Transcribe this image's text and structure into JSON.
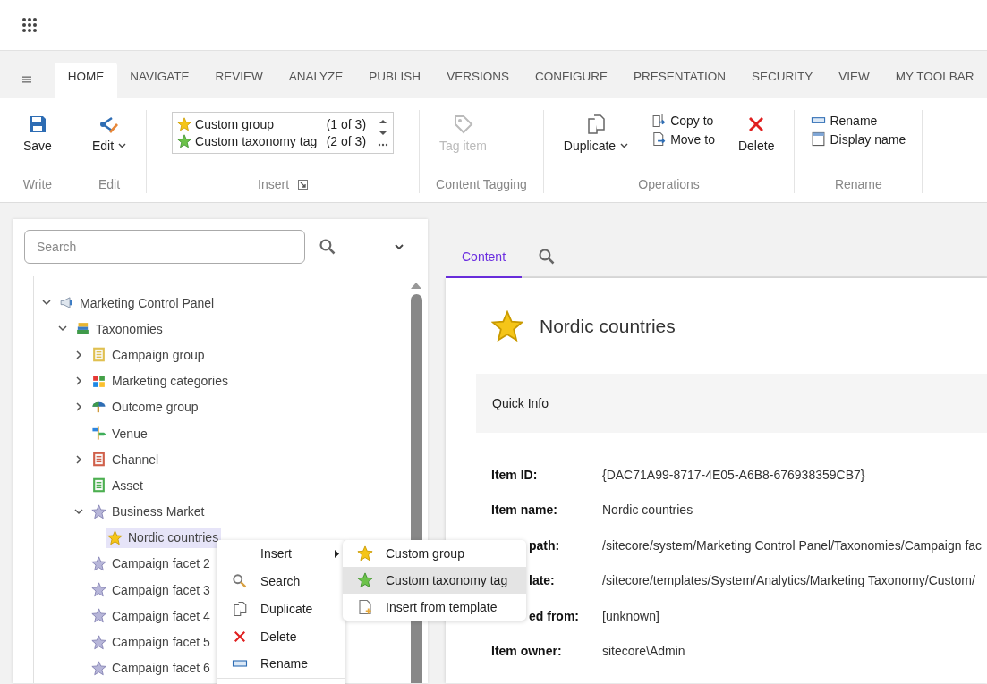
{
  "tabs": [
    {
      "label": "HOME",
      "selected": true
    },
    {
      "label": "NAVIGATE",
      "selected": false
    },
    {
      "label": "REVIEW",
      "selected": false
    },
    {
      "label": "ANALYZE",
      "selected": false
    },
    {
      "label": "PUBLISH",
      "selected": false
    },
    {
      "label": "VERSIONS",
      "selected": false
    },
    {
      "label": "CONFIGURE",
      "selected": false
    },
    {
      "label": "PRESENTATION",
      "selected": false
    },
    {
      "label": "SECURITY",
      "selected": false
    },
    {
      "label": "VIEW",
      "selected": false
    },
    {
      "label": "MY TOOLBAR",
      "selected": false
    }
  ],
  "ribbon": [
    {
      "label": "Write",
      "columns": [
        [
          {
            "kind": "save",
            "label": "Save",
            "disabled": false
          }
        ]
      ]
    },
    {
      "label": "Edit",
      "columns": [
        [
          {
            "kind": "edit",
            "label": "Edit",
            "dropdown": true,
            "disabled": false
          }
        ]
      ]
    },
    {
      "label": "Insert",
      "launcher": true,
      "gallery": [
        {
          "label": "Custom group",
          "count": "(1 of 3)",
          "color": "#f5c518"
        },
        {
          "label": "Custom taxonomy tag",
          "count": "(2 of 3)",
          "color": "#6cc24a"
        }
      ]
    },
    {
      "label": "Content Tagging",
      "columns": [
        [
          {
            "kind": "tag",
            "label": "Tag item",
            "disabled": true
          }
        ]
      ]
    },
    {
      "label": "Operations",
      "columns": [
        [
          {
            "kind": "duplicate",
            "label": "Duplicate",
            "dropdown": true,
            "disabled": false
          }
        ],
        [
          {
            "kind": "copy",
            "label": "Copy to",
            "disabled": false
          },
          {
            "kind": "move",
            "label": "Move to",
            "disabled": false
          }
        ],
        [
          {
            "kind": "delete",
            "label": "Delete",
            "disabled": false
          }
        ]
      ]
    },
    {
      "label": "Rename",
      "columns": [
        [
          {
            "kind": "rename",
            "label": "Rename",
            "disabled": false
          },
          {
            "kind": "display",
            "label": "Display name",
            "disabled": false
          }
        ]
      ]
    }
  ],
  "tree_search": {
    "placeholder": "Search"
  },
  "tree": [
    {
      "label": "Marketing Control Panel",
      "kind": "megaphone",
      "expanded": true,
      "selected": false,
      "children": [
        {
          "label": "Taxonomies",
          "kind": "books",
          "expanded": true,
          "selected": false,
          "children": [
            {
              "label": "Campaign group",
              "kind": "sheet",
              "color": "#e0c050",
              "expanded": false,
              "selected": false
            },
            {
              "label": "Marketing categories",
              "kind": "cube",
              "expanded": false,
              "selected": false
            },
            {
              "label": "Outcome group",
              "kind": "umbrella",
              "expanded": false,
              "selected": false
            },
            {
              "label": "Venue",
              "kind": "signpost",
              "selected": false
            },
            {
              "label": "Channel",
              "kind": "sheet",
              "color": "#d0604a",
              "expanded": false,
              "selected": false
            },
            {
              "label": "Asset",
              "kind": "sheet",
              "color": "#4caf50",
              "selected": false
            },
            {
              "label": "Business Market",
              "kind": "star",
              "color": "#b7b6d9",
              "expanded": true,
              "selected": false,
              "children": [
                {
                  "label": "Nordic countries",
                  "kind": "star",
                  "color": "#f5c518",
                  "selected": true
                }
              ]
            },
            {
              "label": "Campaign facet 2",
              "kind": "star",
              "color": "#b7b6d9",
              "selected": false
            },
            {
              "label": "Campaign facet 3",
              "kind": "star",
              "color": "#b7b6d9",
              "selected": false
            },
            {
              "label": "Campaign facet 4",
              "kind": "star",
              "color": "#b7b6d9",
              "selected": false
            },
            {
              "label": "Campaign facet 5",
              "kind": "star",
              "color": "#b7b6d9",
              "selected": false
            },
            {
              "label": "Campaign facet 6",
              "kind": "star",
              "color": "#b7b6d9",
              "selected": false
            }
          ]
        }
      ]
    }
  ],
  "context_menu": {
    "items": [
      {
        "label": "Insert",
        "kind": "insert",
        "submenu": true
      },
      {
        "label": "Search",
        "kind": "search"
      },
      {
        "label": "Duplicate",
        "kind": "duplicate",
        "separator_before": true
      },
      {
        "label": "Delete",
        "kind": "delete"
      },
      {
        "label": "Rename",
        "kind": "rename"
      }
    ],
    "submenu": [
      {
        "label": "Custom group",
        "kind": "star",
        "color": "#f5c518",
        "selected": false
      },
      {
        "label": "Custom taxonomy tag",
        "kind": "star",
        "color": "#6cc24a",
        "selected": true
      },
      {
        "label": "Insert from template",
        "kind": "template",
        "selected": false
      }
    ]
  },
  "editor_tabs": [
    {
      "kind": "text",
      "label": "Content",
      "selected": true
    },
    {
      "kind": "search",
      "selected": false
    }
  ],
  "item": {
    "title": "Nordic countries",
    "section": "Quick Info",
    "fields": [
      {
        "label": "Item ID:",
        "value": "{DAC71A99-8717-4E05-A6B8-676938359CB7}"
      },
      {
        "label": "Item name:",
        "value": "Nordic countries"
      },
      {
        "label": "path:",
        "value": "/sitecore/system/Marketing Control Panel/Taxonomies/Campaign fac",
        "clipped": true
      },
      {
        "label": "late:",
        "value": "/sitecore/templates/System/Analytics/Marketing Taxonomy/Custom/",
        "clipped": true
      },
      {
        "label": "ed from:",
        "value": "[unknown]",
        "clipped": true
      },
      {
        "label": "Item owner:",
        "value": "sitecore\\Admin"
      }
    ]
  }
}
